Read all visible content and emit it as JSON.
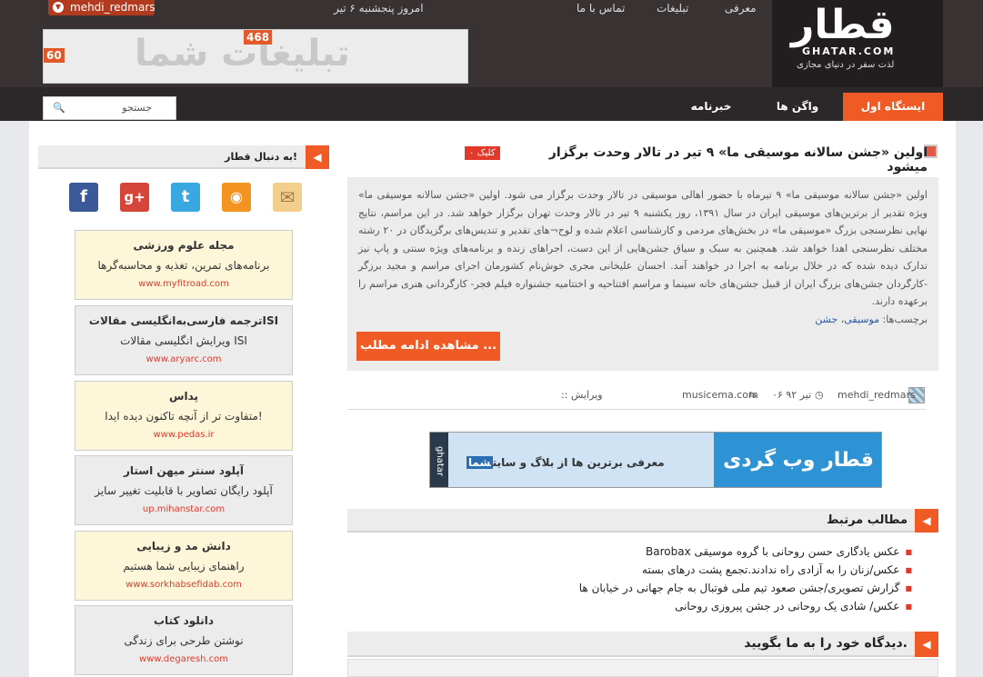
{
  "header": {
    "logo_main": "قطار",
    "logo_sub": "GHATAR.COM",
    "logo_tagline": "لذت سفر در دنیای مجازی",
    "nav": [
      "معرفی",
      "تبلیغات",
      "تماس با ما"
    ],
    "date": "امروز پنجشنبه ۶ تیر",
    "username": "mehdi_redmars",
    "banner_text": "تبلیغات شما",
    "banner_width": "468",
    "banner_height": "60",
    "search_placeholder": "جستجو",
    "tabs": [
      "ایستگاه اول",
      "واگن ها",
      "خبرنامه"
    ]
  },
  "post": {
    "title": "اولین «جشن سالانه موسیقی ما» ۹ تیر در تالار وحدت برگزار میشود",
    "clicks": "۰ کلیک",
    "excerpt": "اولین «جشن سالانه موسیقی ما» ۹ تیرماه با حضور اهالی موسیقی در تالار وحدت برگزار می شود. اولین «جشن سالانه موسیقی ما» ویژه تقدیر از برترین‌های موسیقی ایران در سال ۱۳۹۱، روز یکشنبه ۹ تیر در تالار وحدت تهران برگزار خواهد شد. در این مراسم، نتایج نهایی نظرسنجی بزرگ «موسیقی ما» در بخش‌های مردمی و کارشناسی اعلام شده و لوح¬های تقدیر و تندیس‌های برگزیدگان در ۲۰ رشته مختلف نظرسنجی اهدا خواهد شد. همچنین به سبک و سیاق جشن‌هایی از این دست، اجراهای زنده و برنامه‌های ویژه سنتی و پاپ نیز تدارک دیده شده که در خلال برنامه به اجرا در خواهند آمد. احسان علیخانی مجری خوش‌نام کشورمان اجرای مراسم و مجید برزگر -کارگردان جشن‌های بزرگ ایران از قبیل جشن‌های خانه سینما و مراسم افتتاحیه و اختتامیه جشنواره فیلم فجر- کارگردانی هنری مراسم را برعهده دارند.",
    "tags_label": "برچسب‌ها:",
    "tags": [
      "موسیقی",
      "جشن"
    ],
    "more_button": "مشاهده ادامه مطلب ...",
    "author": "mehdi_redmars",
    "date": "۰۶ تیر ۹۲",
    "source": "musicema.com",
    "edit": ":: ویرایش"
  },
  "ad_banner": {
    "side": "ghatar",
    "line1": "معرفی برترین ها از بلاگ و سایت",
    "highlight": "شما",
    "brand": "قطار وب گردی"
  },
  "related": {
    "title": "مطالب مرتبط",
    "items": [
      "عکس یادگاری حسن روحانی با گروه موسیقی Barobax",
      "عکس/زنان را به آزادی راه ندادند.تجمع پشت درهای بسته",
      "گزارش تصویری/جشن صعود تیم ملی فوتبال به جام جهانی در خیابان ها",
      "عکس/ شادی یک روحانی در جشن پیروزی روحانی"
    ]
  },
  "comment": {
    "title": "دیدگاه خود را به ما بگویید."
  },
  "sidebar": {
    "title": "به دنبال قطار!",
    "social": [
      "facebook-icon",
      "googleplus-icon",
      "twitter-icon",
      "rss-icon",
      "email-icon"
    ],
    "ads": [
      {
        "title": "مجله علوم ورزشی",
        "desc": "برنامه‌های تمرین، تغذیه و محاسبه‌گرها",
        "url": "www.myfitroad.com"
      },
      {
        "title": "ترجمه فارسی‌به‌انگلیسی مقالات‌ISI",
        "desc": "ویرایش انگلیسی مقالات ISI",
        "url": "www.aryarc.com"
      },
      {
        "title": "پداس",
        "desc": "متفاوت تر از آنچه تاکنون دیده ایدا!",
        "url": "www.pedas.ir"
      },
      {
        "title": "آپلود سنتر میهن استار",
        "desc": "آپلود رایگان تصاویر با قابلیت تغییر سایز",
        "url": "up.mihanstar.com"
      },
      {
        "title": "دانش مد و زیبایی",
        "desc": "راهنمای زیبایی شما هستیم",
        "url": "www.sorkhabsefidab.com"
      },
      {
        "title": "دانلود کتاب",
        "desc": "نوشتن طرحی برای زندگی",
        "url": "www.degaresh.com"
      }
    ]
  },
  "colors": {
    "accent": "#f05a24",
    "header": "#383233",
    "link": "#2a5aa8"
  }
}
